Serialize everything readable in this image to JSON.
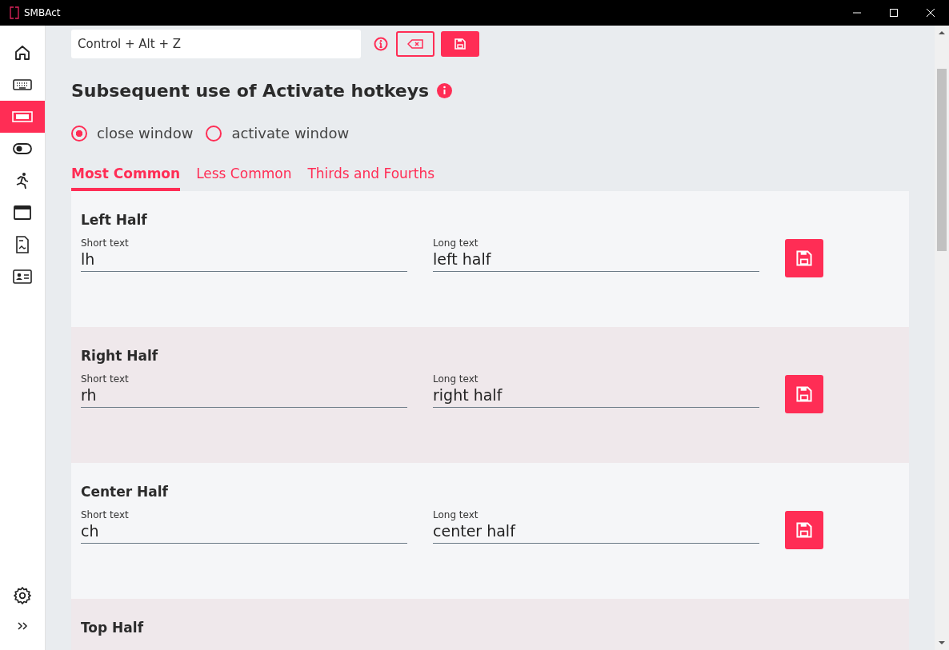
{
  "window": {
    "title": "SMBAct"
  },
  "sidebar": {
    "items": [
      {
        "kind": "home",
        "selected": false
      },
      {
        "kind": "keyboard",
        "selected": false
      },
      {
        "kind": "ab",
        "selected": true
      },
      {
        "kind": "toggle",
        "selected": false
      },
      {
        "kind": "runner",
        "selected": false
      },
      {
        "kind": "window",
        "selected": false
      },
      {
        "kind": "document",
        "selected": false
      },
      {
        "kind": "card",
        "selected": false
      }
    ],
    "bottom": [
      {
        "kind": "gear"
      },
      {
        "kind": "chevrons"
      }
    ]
  },
  "hotkey": {
    "value": "Control + Alt + Z"
  },
  "heading": "Subsequent use of Activate hotkeys",
  "radios": [
    {
      "label": "close window",
      "selected": true
    },
    {
      "label": "activate window",
      "selected": false
    }
  ],
  "tabs": [
    {
      "label": "Most Common",
      "selected": true
    },
    {
      "label": "Less Common",
      "selected": false
    },
    {
      "label": "Thirds and Fourths",
      "selected": false
    }
  ],
  "cards": [
    {
      "title": "Left Half",
      "short_label": "Short text",
      "short_value": "lh",
      "long_label": "Long text",
      "long_value": "left half"
    },
    {
      "title": "Right Half",
      "short_label": "Short text",
      "short_value": "rh",
      "long_label": "Long text",
      "long_value": "right half"
    },
    {
      "title": "Center Half",
      "short_label": "Short text",
      "short_value": "ch",
      "long_label": "Long text",
      "long_value": "center half"
    },
    {
      "title": "Top Half"
    }
  ]
}
